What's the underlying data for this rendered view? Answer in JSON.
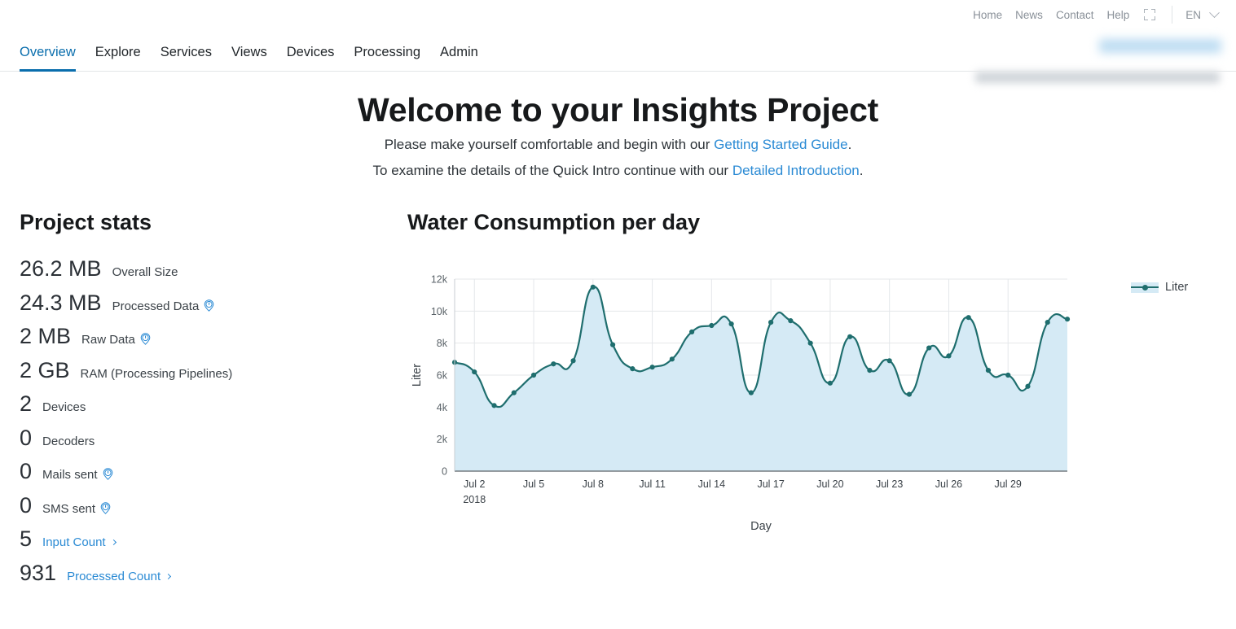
{
  "topbar": {
    "links": [
      "Home",
      "News",
      "Contact",
      "Help"
    ],
    "fullscreen_icon": "fullscreen-icon",
    "language": "EN",
    "chevron_icon": "chevron-down-icon"
  },
  "mainnav": {
    "tabs": [
      {
        "label": "Overview",
        "active": true
      },
      {
        "label": "Explore",
        "active": false
      },
      {
        "label": "Services",
        "active": false
      },
      {
        "label": "Views",
        "active": false
      },
      {
        "label": "Devices",
        "active": false
      },
      {
        "label": "Processing",
        "active": false
      },
      {
        "label": "Admin",
        "active": false
      }
    ],
    "accent_color": "#0a6ead"
  },
  "hero": {
    "title": "Welcome to your Insights Project",
    "line1_prefix": "Please make yourself comfortable and begin with our ",
    "line1_link": "Getting Started Guide",
    "line1_suffix": ".",
    "line2_prefix": "To examine the details of the Quick Intro continue with our ",
    "line2_link": "Detailed Introduction",
    "line2_suffix": ".",
    "link_color": "#2a8ad4"
  },
  "stats": {
    "heading": "Project stats",
    "rows": [
      {
        "value": "26.2 MB",
        "label": "Overall Size",
        "info": false,
        "link": false,
        "chevron": false
      },
      {
        "value": "24.3 MB",
        "label": "Processed Data",
        "info": true,
        "link": false,
        "chevron": false
      },
      {
        "value": "2 MB",
        "label": "Raw Data",
        "info": true,
        "link": false,
        "chevron": false
      },
      {
        "value": "2 GB",
        "label": "RAM (Processing Pipelines)",
        "info": false,
        "link": false,
        "chevron": false
      },
      {
        "value": "2",
        "label": "Devices",
        "info": false,
        "link": false,
        "chevron": false
      },
      {
        "value": "0",
        "label": "Decoders",
        "info": false,
        "link": false,
        "chevron": false
      },
      {
        "value": "0",
        "label": "Mails sent",
        "info": true,
        "link": false,
        "chevron": false
      },
      {
        "value": "0",
        "label": "SMS sent",
        "info": true,
        "link": false,
        "chevron": false
      },
      {
        "value": "5",
        "label": "Input Count",
        "info": false,
        "link": true,
        "chevron": true
      },
      {
        "value": "931",
        "label": "Processed Count",
        "info": false,
        "link": true,
        "chevron": true
      }
    ]
  },
  "chart_data": {
    "type": "area",
    "title": "Water Consumption per day",
    "xlabel": "Day",
    "ylabel": "Liter",
    "legend": [
      "Liter"
    ],
    "legend_position": "right",
    "grid": true,
    "line_color": "#1f6e6e",
    "fill_color": "#d5eaf5",
    "ylim": [
      0,
      12000
    ],
    "ytick_values": [
      0,
      2000,
      4000,
      6000,
      8000,
      10000,
      12000
    ],
    "ytick_labels": [
      "0",
      "2k",
      "4k",
      "6k",
      "8k",
      "10k",
      "12k"
    ],
    "x_axis_subtitle": "2018",
    "xtick_labels": [
      "Jul 2",
      "Jul 5",
      "Jul 8",
      "Jul 11",
      "Jul 14",
      "Jul 17",
      "Jul 20",
      "Jul 23",
      "Jul 26",
      "Jul 29"
    ],
    "xtick_indices": [
      1,
      4,
      7,
      10,
      13,
      16,
      19,
      22,
      25,
      28
    ],
    "x": [
      "Jul 1",
      "Jul 2",
      "Jul 3",
      "Jul 4",
      "Jul 5",
      "Jul 6",
      "Jul 7",
      "Jul 8",
      "Jul 9",
      "Jul 10",
      "Jul 11",
      "Jul 12",
      "Jul 13",
      "Jul 14",
      "Jul 15",
      "Jul 16",
      "Jul 17",
      "Jul 18",
      "Jul 19",
      "Jul 20",
      "Jul 21",
      "Jul 22",
      "Jul 23",
      "Jul 24",
      "Jul 25",
      "Jul 26",
      "Jul 27",
      "Jul 28",
      "Jul 29",
      "Jul 30"
    ],
    "series": [
      {
        "name": "Liter",
        "values": [
          6800,
          6200,
          4100,
          4900,
          6000,
          6700,
          6900,
          11500,
          7900,
          6400,
          6500,
          7000,
          8700,
          9100,
          9200,
          4900,
          9300,
          9400,
          8000,
          5500,
          8400,
          6300,
          6900,
          4800,
          7700,
          7200,
          9600,
          6300,
          6000,
          5300,
          9300,
          9500
        ]
      }
    ]
  }
}
